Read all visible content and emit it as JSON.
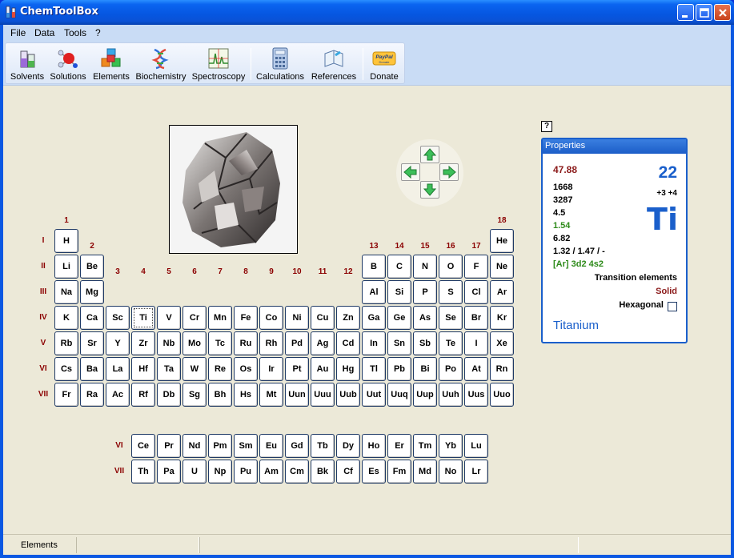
{
  "window": {
    "title": "ChemToolBox"
  },
  "menu": [
    {
      "label": "File",
      "key": "F"
    },
    {
      "label": "Data",
      "key": "D"
    },
    {
      "label": "Tools",
      "key": "T"
    },
    {
      "label": "?",
      "key": "?"
    }
  ],
  "toolbar": {
    "items": [
      {
        "label": "Solvents",
        "icon": "solvents-icon"
      },
      {
        "label": "Solutions",
        "icon": "solutions-icon"
      },
      {
        "label": "Elements",
        "icon": "elements-icon"
      },
      {
        "label": "Biochemistry",
        "icon": "biochemistry-icon"
      },
      {
        "label": "Spectroscopy",
        "icon": "spectroscopy-icon"
      },
      {
        "label": "Calculations",
        "icon": "calculator-icon"
      },
      {
        "label": "References",
        "icon": "book-icon"
      },
      {
        "label": "Donate",
        "icon": "paypal-donate-icon"
      }
    ]
  },
  "periodic_table": {
    "groups": [
      "1",
      "2",
      "3",
      "4",
      "5",
      "6",
      "7",
      "8",
      "9",
      "10",
      "11",
      "12",
      "13",
      "14",
      "15",
      "16",
      "17",
      "18"
    ],
    "periods": [
      "I",
      "II",
      "III",
      "IV",
      "V",
      "VI",
      "VII"
    ],
    "rows": [
      [
        "H",
        "",
        "",
        "",
        "",
        "",
        "",
        "",
        "",
        "",
        "",
        "",
        "",
        "",
        "",
        "",
        "",
        "He"
      ],
      [
        "Li",
        "Be",
        "",
        "",
        "",
        "",
        "",
        "",
        "",
        "",
        "",
        "",
        "B",
        "C",
        "N",
        "O",
        "F",
        "Ne"
      ],
      [
        "Na",
        "Mg",
        "",
        "",
        "",
        "",
        "",
        "",
        "",
        "",
        "",
        "",
        "Al",
        "Si",
        "P",
        "S",
        "Cl",
        "Ar"
      ],
      [
        "K",
        "Ca",
        "Sc",
        "Ti",
        "V",
        "Cr",
        "Mn",
        "Fe",
        "Co",
        "Ni",
        "Cu",
        "Zn",
        "Ga",
        "Ge",
        "As",
        "Se",
        "Br",
        "Kr"
      ],
      [
        "Rb",
        "Sr",
        "Y",
        "Zr",
        "Nb",
        "Mo",
        "Tc",
        "Ru",
        "Rh",
        "Pd",
        "Ag",
        "Cd",
        "In",
        "Sn",
        "Sb",
        "Te",
        "I",
        "Xe"
      ],
      [
        "Cs",
        "Ba",
        "La",
        "Hf",
        "Ta",
        "W",
        "Re",
        "Os",
        "Ir",
        "Pt",
        "Au",
        "Hg",
        "Tl",
        "Pb",
        "Bi",
        "Po",
        "At",
        "Rn"
      ],
      [
        "Fr",
        "Ra",
        "Ac",
        "Rf",
        "Db",
        "Sg",
        "Bh",
        "Hs",
        "Mt",
        "Uun",
        "Uuu",
        "Uub",
        "Uut",
        "Uuq",
        "Uup",
        "Uuh",
        "Uus",
        "Uuo"
      ]
    ],
    "selected": "Ti",
    "f_block": {
      "periods": [
        "VI",
        "VII"
      ],
      "rows": [
        [
          "Ce",
          "Pr",
          "Nd",
          "Pm",
          "Sm",
          "Eu",
          "Gd",
          "Tb",
          "Dy",
          "Ho",
          "Er",
          "Tm",
          "Yb",
          "Lu"
        ],
        [
          "Th",
          "Pa",
          "U",
          "Np",
          "Pu",
          "Am",
          "Cm",
          "Bk",
          "Cf",
          "Es",
          "Fm",
          "Md",
          "No",
          "Lr"
        ]
      ]
    }
  },
  "properties": {
    "header": "Properties",
    "help_label": "?",
    "atomic_mass": "47.88",
    "atomic_number": "22",
    "melting_point": "1668",
    "boiling_point": "3287",
    "density": "4.5",
    "electronegativity": "1.54",
    "ionization": "6.82",
    "radii": "1.32 / 1.47 / -",
    "electron_config": "[Ar] 3d2 4s2",
    "oxidation_states": "+3 +4",
    "symbol": "Ti",
    "category": "Transition elements",
    "state": "Solid",
    "crystal": "Hexagonal",
    "name": "Titanium",
    "colors": {
      "mass": "#8B1A1A",
      "number": "#1A5FCB",
      "electronegativity": "#2E8B1A",
      "state": "#8B1A1A"
    }
  },
  "status": {
    "text": "Elements"
  }
}
